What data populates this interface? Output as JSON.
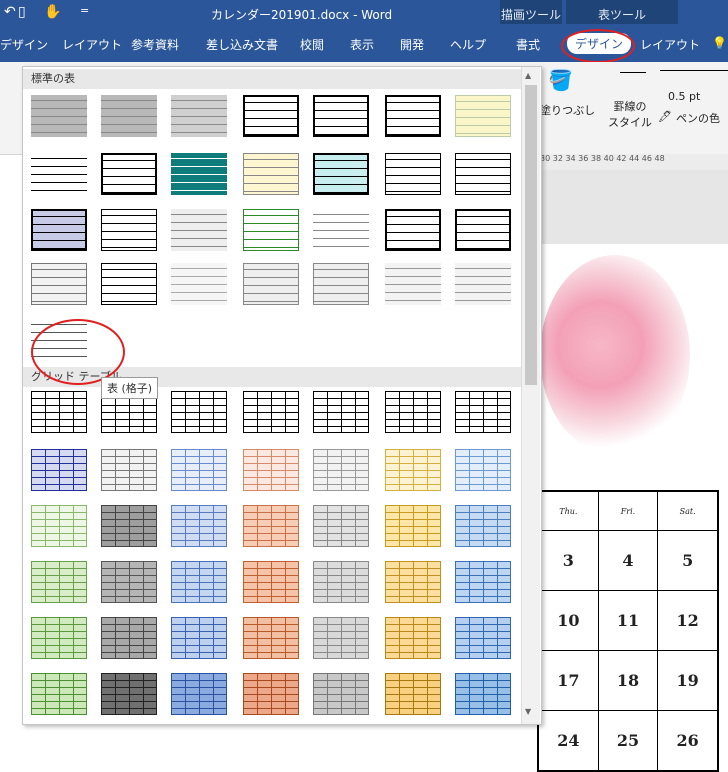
{
  "titlebar": {
    "doc_title": "カレンダー201901.docx  -  Word",
    "context_drawing": "描画ツール",
    "context_table": "表ツール",
    "tabs": [
      "デザイン",
      "レイアウト",
      "参考資料",
      "差し込み文書",
      "校閲",
      "表示",
      "開発",
      "ヘルプ",
      "書式",
      "デザイン",
      "レイアウト"
    ],
    "active_tab": "デザイン"
  },
  "ribbon": {
    "shading": "塗りつぶし",
    "border_style": "罫線の\nスタイル",
    "pen_width": "0.5 pt",
    "pen_color": "ペンの色"
  },
  "ruler": {
    "text": "30 32 34 36 38 40 42 44 46 48"
  },
  "gallery": {
    "section_plain": "標準の表",
    "section_grid": "グリッド テーブル",
    "tooltip": "表 (格子)"
  },
  "calendar": {
    "headers": [
      "Thu.",
      "Fri.",
      "Sat."
    ],
    "rows": [
      [
        "3",
        "4",
        "5"
      ],
      [
        "10",
        "11",
        "12"
      ],
      [
        "17",
        "18",
        "19"
      ],
      [
        "24",
        "25",
        "26"
      ]
    ]
  }
}
